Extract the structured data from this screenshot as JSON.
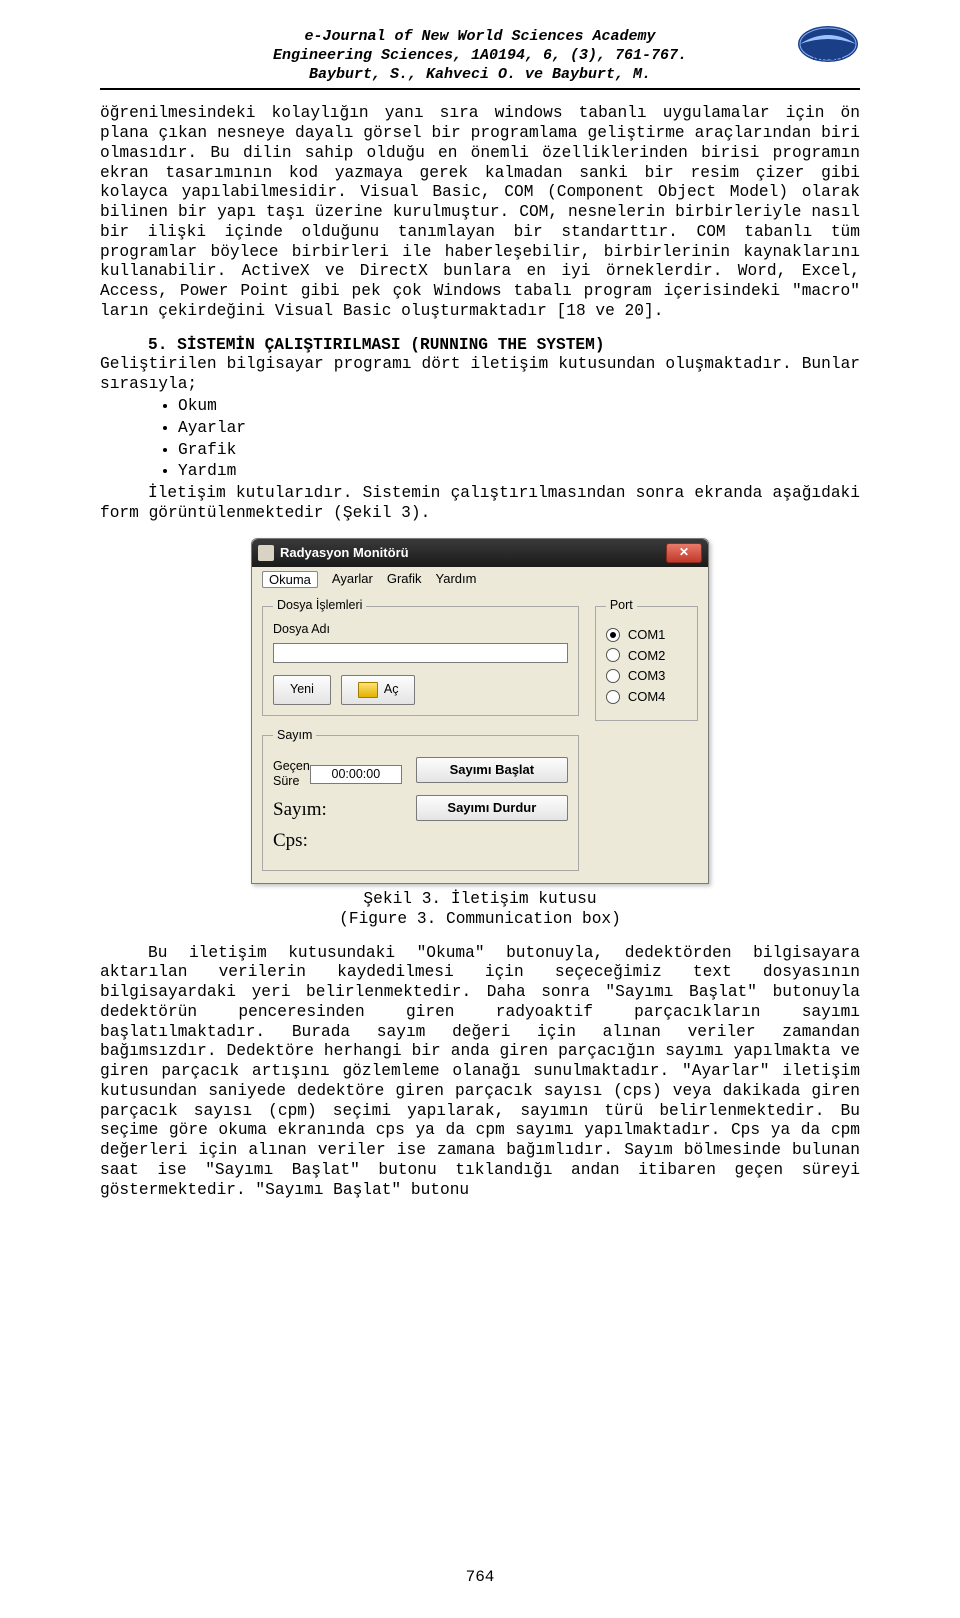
{
  "header": {
    "line1": "e-Journal of New World Sciences Academy",
    "line2": "Engineering Sciences, 1A0194, 6, (3), 761-767.",
    "line3": "Bayburt, S., Kahveci O. ve Bayburt, M.",
    "logo_text": "NWSA"
  },
  "paragraphs": {
    "p1": "öğrenilmesindeki kolaylığın yanı sıra windows tabanlı uygulamalar için ön plana çıkan nesneye dayalı görsel bir programlama geliştirme araçlarından biri olmasıdır. Bu dilin sahip olduğu en önemli özelliklerinden birisi programın ekran tasarımının kod yazmaya gerek kalmadan sanki bir resim çizer gibi kolayca yapılabilmesidir. Visual Basic, COM (Component Object Model) olarak bilinen bir yapı taşı üzerine kurulmuştur. COM, nesnelerin birbirleriyle nasıl bir ilişki içinde olduğunu tanımlayan bir standarttır. COM tabanlı tüm programlar böylece birbirleri ile haberleşebilir, birbirlerinin kaynaklarını kullanabilir. ActiveX ve DirectX bunlara en iyi örneklerdir. Word, Excel, Access, Power Point gibi pek çok Windows tabalı program içerisindeki \"macro\" ların çekirdeğini Visual Basic oluşturmaktadır [18 ve 20].",
    "s5_title": "5. SİSTEMİN ÇALIŞTIRILMASI (RUNNING THE SYSTEM)",
    "s5_intro_a": "Geliştirilen bilgisayar programı dört iletişim kutusundan oluşmaktadır. Bunlar sırasıyla;",
    "s5_after": "İletişim kutularıdır. Sistemin çalıştırılmasından sonra ekranda aşağıdaki form görüntülenmektedir (Şekil 3).",
    "caption_a": "Şekil 3. İletişim kutusu",
    "caption_b": "(Figure 3. Communication box)",
    "p_last": "Bu iletişim kutusundaki \"Okuma\" butonuyla, dedektörden bilgisayara aktarılan verilerin kaydedilmesi için seçeceğimiz text dosyasının bilgisayardaki yeri belirlenmektedir. Daha sonra \"Sayımı Başlat\" butonuyla dedektörün penceresinden giren radyoaktif parçacıkların sayımı başlatılmaktadır. Burada sayım değeri için alınan veriler zamandan bağımsızdır. Dedektöre herhangi bir anda giren parçacığın sayımı yapılmakta ve giren parçacık artışını gözlemleme olanağı sunulmaktadır. \"Ayarlar\" iletişim kutusundan saniyede dedektöre giren parçacık sayısı (cps) veya dakikada giren parçacık sayısı (cpm) seçimi yapılarak, sayımın türü belirlenmektedir. Bu seçime göre okuma ekranında cps ya da cpm sayımı yapılmaktadır. Cps ya da cpm değerleri için alınan veriler ise zamana bağımlıdır. Sayım bölmesinde bulunan saat ise \"Sayımı Başlat\" butonu tıklandığı andan itibaren geçen süreyi göstermektedir. \"Sayımı Başlat\" butonu"
  },
  "bullets": [
    "Okum",
    "Ayarlar",
    "Grafik",
    "Yardım"
  ],
  "dialog": {
    "title": "Radyasyon Monitörü",
    "menus": [
      "Okuma",
      "Ayarlar",
      "Grafik",
      "Yardım"
    ],
    "file_group": "Dosya İşlemleri",
    "file_label": "Dosya Adı",
    "btn_new": "Yeni",
    "btn_open": "Aç",
    "port_group": "Port",
    "ports": [
      "COM1",
      "COM2",
      "COM3",
      "COM4"
    ],
    "port_selected": 0,
    "count_group": "Sayım",
    "elapsed_label": "Geçen Süre",
    "elapsed_value": "00:00:00",
    "count_label": "Sayım:",
    "cps_label": "Cps:",
    "btn_start": "Sayımı Başlat",
    "btn_stop": "Sayımı Durdur"
  },
  "page_number": "764"
}
